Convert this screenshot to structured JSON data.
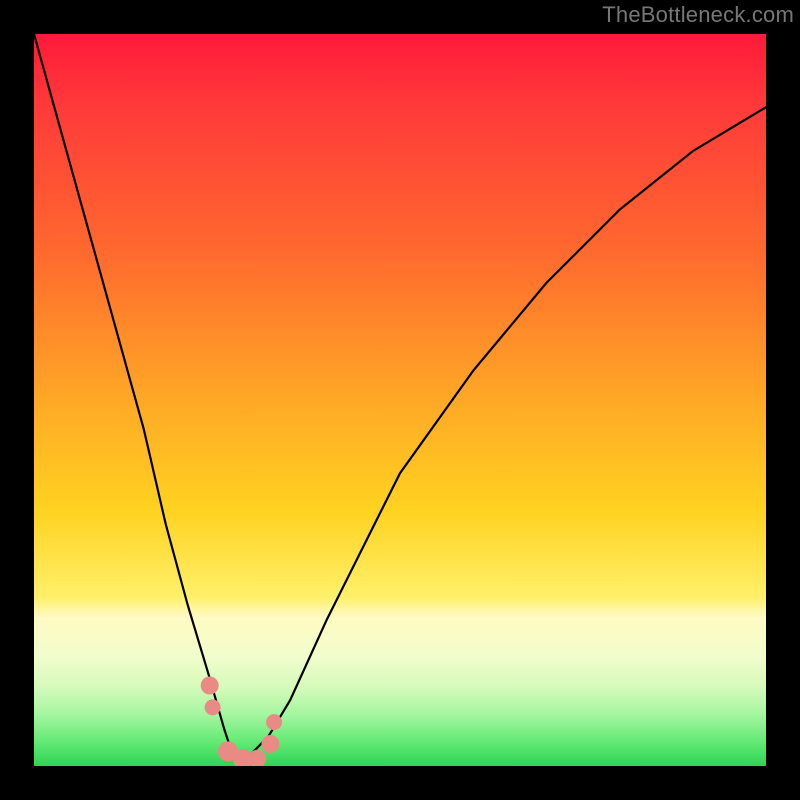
{
  "watermark": {
    "text": "TheBottleneck.com"
  },
  "chart_data": {
    "type": "line",
    "title": "",
    "xlabel": "",
    "ylabel": "",
    "xlim": [
      0,
      100
    ],
    "ylim": [
      0,
      100
    ],
    "legend": false,
    "grid": false,
    "series": [
      {
        "name": "bottleneck-curve",
        "x": [
          0,
          5,
          10,
          15,
          18,
          21,
          24,
          26,
          27,
          28,
          29,
          30,
          32,
          35,
          40,
          50,
          60,
          70,
          80,
          90,
          100
        ],
        "y": [
          100,
          82,
          64,
          46,
          33,
          22,
          12,
          5,
          2,
          1,
          1,
          2,
          4,
          9,
          20,
          40,
          54,
          66,
          76,
          84,
          90
        ]
      }
    ],
    "scatter_points": [
      {
        "name": "marker-a",
        "x": 24.0,
        "y": 11,
        "r": 9
      },
      {
        "name": "marker-b",
        "x": 24.4,
        "y": 8,
        "r": 8
      },
      {
        "name": "marker-c",
        "x": 26.5,
        "y": 2,
        "r": 10
      },
      {
        "name": "marker-d",
        "x": 28.5,
        "y": 1,
        "r": 10
      },
      {
        "name": "marker-e",
        "x": 30.5,
        "y": 1,
        "r": 9
      },
      {
        "name": "marker-f",
        "x": 32.3,
        "y": 3,
        "r": 9
      },
      {
        "name": "marker-g",
        "x": 32.8,
        "y": 6,
        "r": 8
      }
    ],
    "gradient_stops": [
      {
        "pct": 0,
        "color": "#ff1a3a"
      },
      {
        "pct": 30,
        "color": "#ff6a2e"
      },
      {
        "pct": 65,
        "color": "#ffd220"
      },
      {
        "pct": 82,
        "color": "#fffbc0"
      },
      {
        "pct": 100,
        "color": "#1ece4e"
      }
    ]
  }
}
